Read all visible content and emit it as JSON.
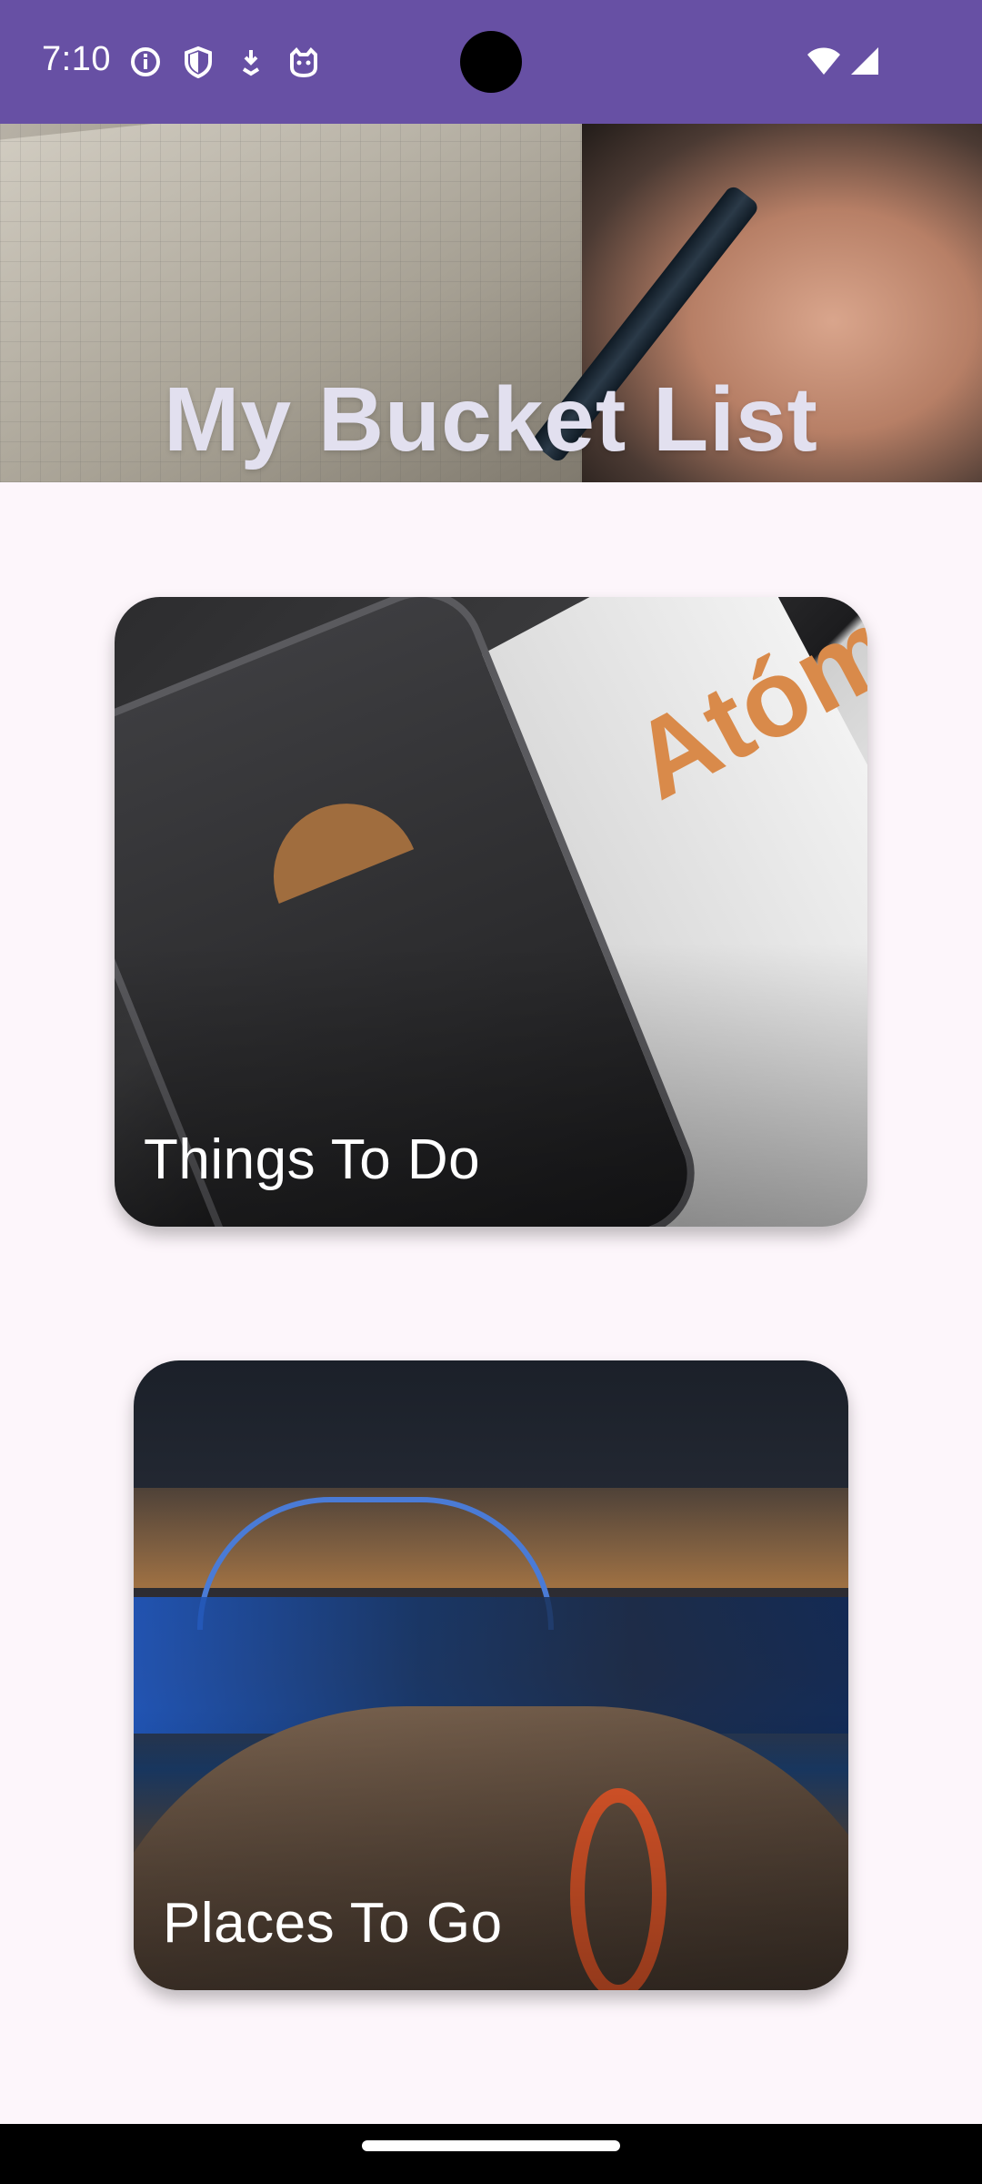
{
  "status_bar": {
    "time": "7:10",
    "icons_left": [
      "info-icon",
      "shield-icon",
      "download-icon",
      "cat-icon"
    ],
    "icons_right": [
      "wifi-icon",
      "signal-icon"
    ],
    "background": "#6750a4"
  },
  "header": {
    "title": "My Bucket List"
  },
  "cards": [
    {
      "label": "Things To Do",
      "image": "phone-and-book-photo"
    },
    {
      "label": "Places To Go",
      "image": "night-city-waterfront-photo"
    }
  ],
  "colors": {
    "accent": "#6750a4",
    "background": "#fdf6fb",
    "title_text": "#e2e0ef"
  }
}
